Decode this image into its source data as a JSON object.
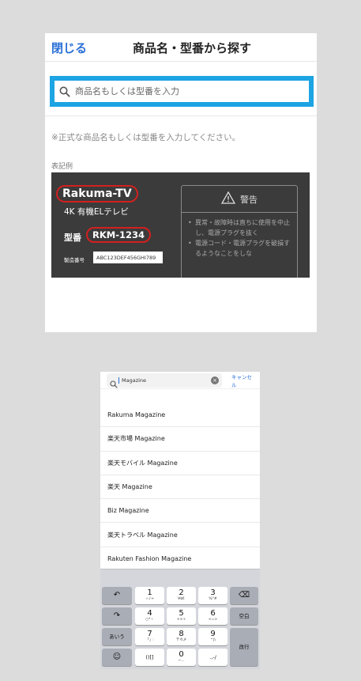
{
  "top_panel": {
    "close_label": "閉じる",
    "title": "商品名・型番から探す",
    "search_placeholder": "商品名もしくは型番を入力",
    "note": "※正式な商品名もしくは型番を入力してください。",
    "example_label": "表記例",
    "example": {
      "brand": "Rakuma-TV",
      "subtitle": "4K 有機ELテレビ",
      "model_label": "型番",
      "model_number": "RKM-1234",
      "serial_label": "製造番号",
      "serial_value": "ABC123DEF456GHI789",
      "warning_title": "警告",
      "warning_items": [
        "異常・故障時は直ちに使用を中止し、電源プラグを抜く",
        "電源コード・電源プラグを破損するようなことをしな"
      ]
    }
  },
  "phone": {
    "search_value": "Magazine",
    "cancel_label": "キャンセル",
    "suggestions": [
      "Rakuma Magazine",
      "楽天市場 Magazine",
      "楽天モバイル Magazine",
      "楽天 Magazine",
      "Biz Magazine",
      "楽天トラベル Magazine",
      "Rakuten Fashion Magazine"
    ],
    "keyboard": {
      "undo": "↶",
      "redo": "↷",
      "aiu": "あいう",
      "emoji": "☺",
      "backspace": "⌫",
      "space": "空白",
      "enter": "改行",
      "k1": "1",
      "k1s": "☆♪→",
      "k2": "2",
      "k2s": "¥$€",
      "k3": "3",
      "k3s": "%°#",
      "k4": "4",
      "k4s": "○*・",
      "k5": "5",
      "k5s": "+×÷",
      "k6": "6",
      "k6s": "<=>",
      "k7": "7",
      "k7s": "「」:",
      "k8": "8",
      "k8s": "〒々〆",
      "k9": "9",
      "k9s": "^|\\",
      "k0": "0",
      "k0s": "~…",
      "brackets": "()[]",
      "punct": ".,-/"
    }
  }
}
